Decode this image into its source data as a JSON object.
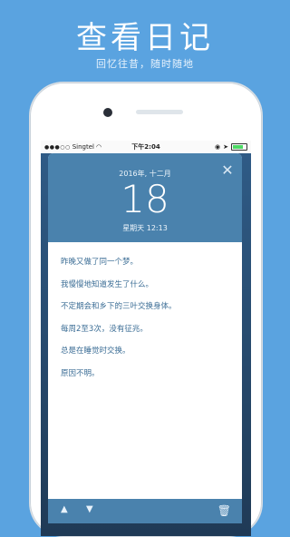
{
  "hero": {
    "title": "查看日记",
    "subtitle": "回忆往昔，随时随地"
  },
  "statusbar": {
    "carrier": "Singtel",
    "time": "下午2:04",
    "dots": "●●●○○"
  },
  "diary": {
    "date_line": "2016年, 十二月",
    "day": "18",
    "weekday_time": "星期天 12:13",
    "lines": [
      "昨晚又做了同一个梦。",
      "我慢慢地知道发生了什么。",
      "不定期会和乡下的三叶交换身体。",
      "每周2至3次，没有征兆。",
      "总是在睡觉时交换。",
      "原因不明。"
    ]
  },
  "colors": {
    "background": "#5aa3e0",
    "accent": "#4a82ad",
    "text": "#3c6e96"
  }
}
